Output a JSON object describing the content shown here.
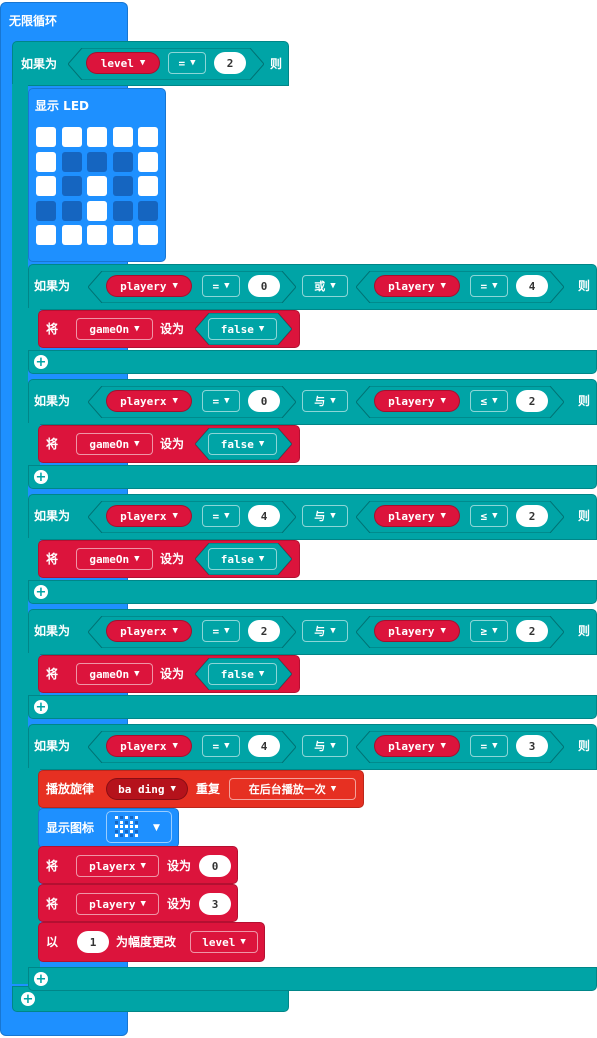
{
  "forever_label": "无限循环",
  "if_label": "如果为",
  "then_label": "则",
  "show_led_label": "显示 LED",
  "set_label": "将",
  "set_to_label": "设为",
  "or_label": "或",
  "and_label": "与",
  "dropdown_arrow": "▼",
  "outer_if": {
    "variable": "level",
    "operator": "=",
    "value": "2"
  },
  "led_grid": [
    [
      1,
      1,
      1,
      1,
      1
    ],
    [
      1,
      0,
      0,
      0,
      1
    ],
    [
      1,
      0,
      1,
      0,
      1
    ],
    [
      0,
      0,
      1,
      0,
      0
    ],
    [
      1,
      1,
      1,
      1,
      1
    ]
  ],
  "conditions": [
    {
      "left_var": "playery",
      "left_op": "=",
      "left_val": "0",
      "logic": "或",
      "right_var": "playery",
      "right_op": "=",
      "right_val": "4",
      "body": {
        "var": "gameOn",
        "value": "false"
      }
    },
    {
      "left_var": "playerx",
      "left_op": "=",
      "left_val": "0",
      "logic": "与",
      "right_var": "playery",
      "right_op": "≤",
      "right_val": "2",
      "body": {
        "var": "gameOn",
        "value": "false"
      }
    },
    {
      "left_var": "playerx",
      "left_op": "=",
      "left_val": "4",
      "logic": "与",
      "right_var": "playery",
      "right_op": "≤",
      "right_val": "2",
      "body": {
        "var": "gameOn",
        "value": "false"
      }
    },
    {
      "left_var": "playerx",
      "left_op": "=",
      "left_val": "2",
      "logic": "与",
      "right_var": "playery",
      "right_op": "≥",
      "right_val": "2",
      "body": {
        "var": "gameOn",
        "value": "false"
      }
    },
    {
      "left_var": "playerx",
      "left_op": "=",
      "left_val": "4",
      "logic": "与",
      "right_var": "playery",
      "right_op": "=",
      "right_val": "3"
    }
  ],
  "melody": {
    "label": "播放旋律",
    "tune": "ba ding",
    "repeat_label": "重复",
    "mode": "在后台播放一次"
  },
  "show_icon_label": "显示图标",
  "icon_grid": [
    [
      1,
      0,
      1,
      0,
      1
    ],
    [
      0,
      1,
      0,
      1,
      0
    ],
    [
      1,
      1,
      1,
      1,
      1
    ],
    [
      0,
      1,
      0,
      1,
      0
    ],
    [
      1,
      0,
      1,
      0,
      1
    ]
  ],
  "set_playerx": {
    "var": "playerx",
    "value": "0"
  },
  "set_playery": {
    "var": "playery",
    "value": "3"
  },
  "change": {
    "prefix": "以",
    "value": "1",
    "middle": "为幅度更改",
    "var": "level"
  }
}
